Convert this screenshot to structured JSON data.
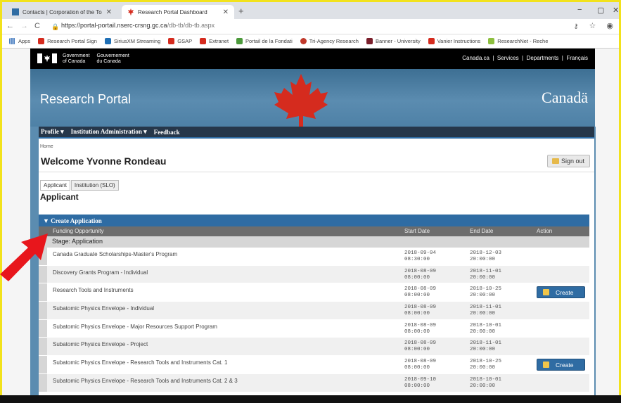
{
  "browser": {
    "tabs": [
      {
        "label": "Contacts | Corporation of the To",
        "active": false
      },
      {
        "label": "Research Portal Dashboard",
        "active": true
      }
    ],
    "url_host": "https://portal-portail.nserc-crsng.gc.ca",
    "url_path": "/db-tb/db-tb.aspx",
    "bookmarks": [
      "Apps",
      "Research Portal Sign",
      "SiriusXM Streaming",
      "GSAP",
      "Extranet",
      "Portail de la Fondati",
      "Tri-Agency Research",
      "Banner - University",
      "Vanier Instructions",
      "ResearchNet - Reche"
    ]
  },
  "goc": {
    "name_en_1": "Government",
    "name_en_2": "of Canada",
    "name_fr_1": "Gouvernement",
    "name_fr_2": "du Canada",
    "links": "Canada.ca  |  Services  |  Departments  |  Français"
  },
  "banner": {
    "title": "Research Portal",
    "wordmark": "Canadä"
  },
  "menu": {
    "profile": "Profile ▾",
    "institution_admin": "Institution Administration ▾",
    "feedback": "Feedback"
  },
  "page": {
    "breadcrumb": "Home",
    "welcome": "Welcome Yvonne Rondeau",
    "sign_out": "Sign out",
    "tab_applicant": "Applicant",
    "tab_institution": "Institution (SLO)",
    "section_title": "Applicant"
  },
  "panel": {
    "header": "▼  Create Application",
    "col_funding": "Funding Opportunity",
    "col_start": "Start Date",
    "col_end": "End Date",
    "col_action": "Action",
    "stage_label": "Stage: Application"
  },
  "rows": [
    {
      "name": "Canada Graduate Scholarships-Master's Program",
      "start_date": "2018-09-04",
      "start_time": "08:30:00",
      "end_date": "2018-12-03",
      "end_time": "20:00:00",
      "action": ""
    },
    {
      "name": "Discovery Grants Program - Individual",
      "start_date": "2018-08-09",
      "start_time": "08:00:00",
      "end_date": "2018-11-01",
      "end_time": "20:00:00",
      "action": ""
    },
    {
      "name": "Research Tools and Instruments",
      "start_date": "2018-08-09",
      "start_time": "08:00:00",
      "end_date": "2018-10-25",
      "end_time": "20:00:00",
      "action": "Create"
    },
    {
      "name": "Subatomic Physics Envelope - Individual",
      "start_date": "2018-08-09",
      "start_time": "08:00:00",
      "end_date": "2018-11-01",
      "end_time": "20:00:00",
      "action": ""
    },
    {
      "name": "Subatomic Physics Envelope - Major Resources Support Program",
      "start_date": "2018-08-09",
      "start_time": "08:00:00",
      "end_date": "2018-10-01",
      "end_time": "20:00:00",
      "action": ""
    },
    {
      "name": "Subatomic Physics Envelope - Project",
      "start_date": "2018-08-09",
      "start_time": "08:00:00",
      "end_date": "2018-11-01",
      "end_time": "20:00:00",
      "action": ""
    },
    {
      "name": "Subatomic Physics Envelope - Research Tools and Instruments Cat. 1",
      "start_date": "2018-08-09",
      "start_time": "08:00:00",
      "end_date": "2018-10-25",
      "end_time": "20:00:00",
      "action": "Create"
    },
    {
      "name": "Subatomic Physics Envelope - Research Tools and Instruments Cat. 2 & 3",
      "start_date": "2018-09-10",
      "start_time": "08:00:00",
      "end_date": "2018-10-01",
      "end_time": "20:00:00",
      "action": ""
    }
  ],
  "colors": {
    "accent": "#2f6ca3",
    "menubar": "#26374a",
    "highlight_frame": "#f2e21c",
    "arrow": "#e8161c"
  }
}
